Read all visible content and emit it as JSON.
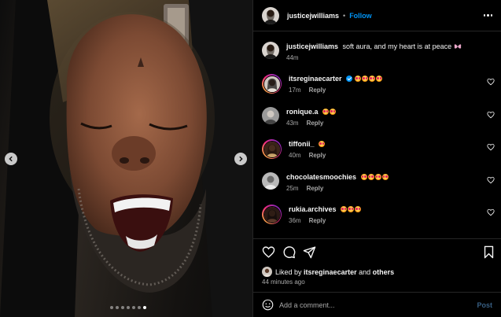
{
  "post": {
    "author": "justicejwilliams",
    "follow_label": "Follow",
    "separator": "•",
    "caption": {
      "username": "justicejwilliams",
      "text": "soft aura, and my heart is at peace",
      "trailing_emoji": "butterfly",
      "time": "44m"
    },
    "colors": {
      "accent": "#0095f6",
      "muted": "#a8a8a8",
      "background": "#000000",
      "divider": "#262626"
    }
  },
  "media": {
    "prev_icon": "chevron-left-icon",
    "next_icon": "chevron-right-icon",
    "carousel": {
      "count": 7,
      "active_index": 6
    }
  },
  "comments": [
    {
      "username": "itsreginaecarter",
      "verified": true,
      "emoji_count": 4,
      "time": "17m",
      "reply": "Reply",
      "ring": true
    },
    {
      "username": "ronique.a",
      "verified": false,
      "emoji_count": 2,
      "time": "43m",
      "reply": "Reply",
      "ring": false
    },
    {
      "username": "tiffonii_",
      "verified": false,
      "emoji_count": 1,
      "time": "40m",
      "reply": "Reply",
      "ring": true
    },
    {
      "username": "chocolatesmoochies",
      "verified": false,
      "emoji_count": 4,
      "time": "25m",
      "reply": "Reply",
      "ring": false
    },
    {
      "username": "rukia.archives",
      "verified": false,
      "emoji_count": 3,
      "time": "36m",
      "reply": "Reply",
      "ring": true
    }
  ],
  "actions": {
    "icons": [
      "heart-icon",
      "comment-icon",
      "share-icon",
      "bookmark-icon"
    ],
    "liked_by_prefix": "Liked by",
    "liked_by_user": "itsreginaecarter",
    "liked_by_and": "and",
    "liked_by_others": "others",
    "time_ago": "44 minutes ago"
  },
  "add_comment": {
    "placeholder": "Add a comment...",
    "post_label": "Post"
  }
}
